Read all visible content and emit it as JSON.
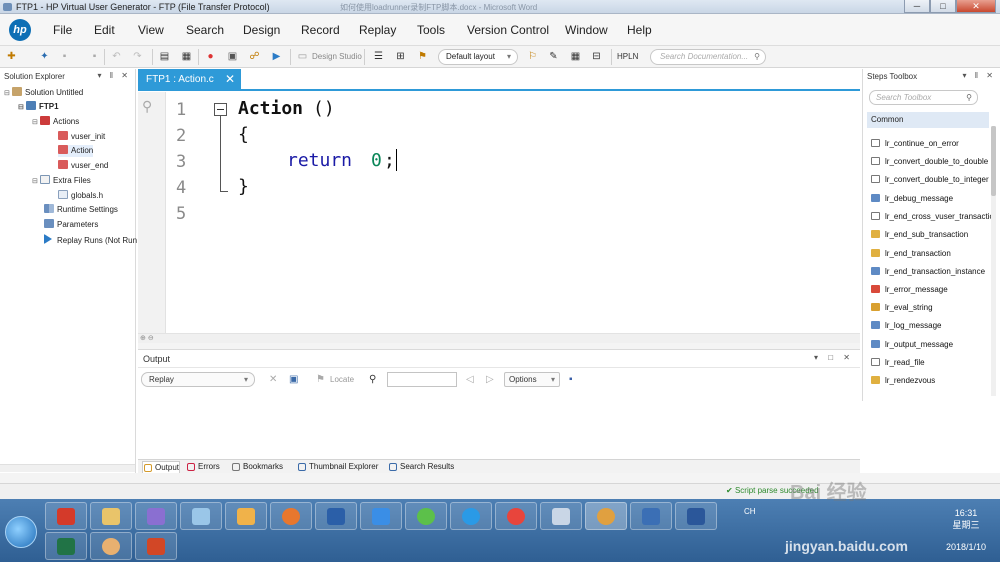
{
  "window": {
    "title": "FTP1 - HP Virtual User Generator - FTP (File Transfer Protocol)",
    "background_doc": "如何使用loadrunner录制FTP脚本.docx - Microsoft Word",
    "buttons": [
      "─",
      "□",
      "✕"
    ]
  },
  "menu": [
    "File",
    "Edit",
    "View",
    "Search",
    "Design",
    "Record",
    "Replay",
    "Tools",
    "Version Control",
    "Window",
    "Help"
  ],
  "toolbar": {
    "design_studio": "Design Studio",
    "layout": "Default layout",
    "hpln": "HPLN",
    "search_placeholder": "Search Documentation..."
  },
  "solution_explorer": {
    "title": "Solution Explorer",
    "pins": "▾ ‖ ✕",
    "solution": "Solution Untitled",
    "project": "FTP1",
    "actions_folder": "Actions",
    "actions": [
      "vuser_init",
      "Action",
      "vuser_end"
    ],
    "extra_folder": "Extra Files",
    "extra_files": [
      "globals.h"
    ],
    "others": [
      "Runtime Settings",
      "Parameters",
      "Replay Runs (Not Run"
    ]
  },
  "editor": {
    "tab_label": "FTP1 : Action.c",
    "line_numbers": [
      "1",
      "2",
      "3",
      "4",
      "5"
    ],
    "code": {
      "func": "Action",
      "parens": "()",
      "open": "{",
      "ret": "return",
      "zero": "0",
      "semi": ";",
      "close": "}"
    }
  },
  "output": {
    "title": "Output",
    "pins": "▾ □ ✕",
    "filter": "Replay",
    "locate": "Locate",
    "options": "Options",
    "tabs": [
      "Output",
      "Errors",
      "Bookmarks",
      "Thumbnail Explorer",
      "Search Results"
    ]
  },
  "steps_toolbox": {
    "title": "Steps Toolbox",
    "pins": "▾ ‖ ✕",
    "search_placeholder": "Search Toolbox",
    "category": "Common",
    "items": [
      "lr_continue_on_error",
      "lr_convert_double_to_double",
      "lr_convert_double_to_integer",
      "lr_debug_message",
      "lr_end_cross_vuser_transaction",
      "lr_end_sub_transaction",
      "lr_end_transaction",
      "lr_end_transaction_instance",
      "lr_error_message",
      "lr_eval_string",
      "lr_log_message",
      "lr_output_message",
      "lr_read_file",
      "lr_rendezvous"
    ]
  },
  "status": {
    "script_parse": "Script parse succeeded"
  },
  "taskbar": {
    "lang": "CH",
    "time": "16:31",
    "weekday": "星期三",
    "date": "2018/1/10"
  },
  "watermark": {
    "cn": "Bai 经验",
    "en": "jingyan.baidu.com"
  }
}
